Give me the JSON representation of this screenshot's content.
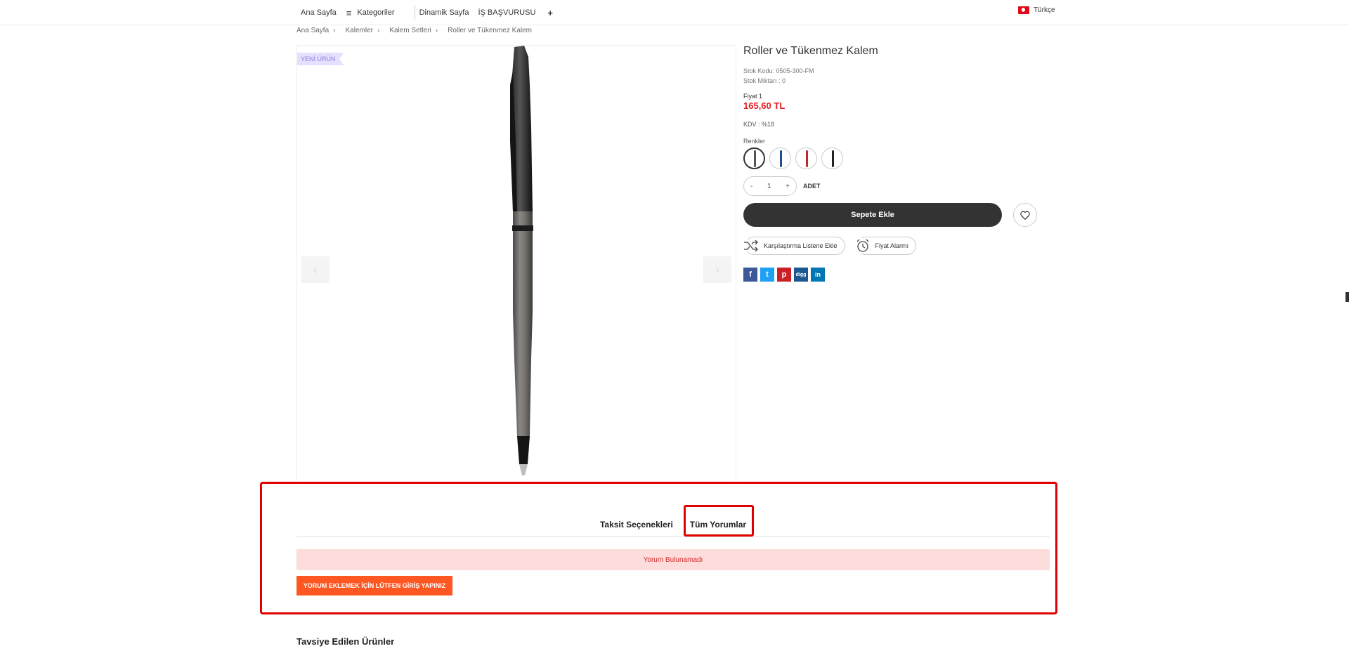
{
  "nav": {
    "home": "Ana Sayfa",
    "categories": "Kategoriler",
    "dynamic_page": "Dinamik Sayfa",
    "job_application": "İŞ BAŞVURUSU",
    "plus": "+",
    "language": "Türkçe"
  },
  "breadcrumb": [
    "Ana Sayfa",
    "Kalemler",
    "Kalem Setleri",
    "Roller ve Tükenmez Kalem"
  ],
  "product": {
    "badge": "YENİ ÜRÜN",
    "title": "Roller ve Tükenmez Kalem",
    "stock_code": "Stok Kodu: 0505-300-FM",
    "stock_qty": "Stok Miktarı : 0",
    "price_label": "Fiyat 1",
    "price": "165,60 TL",
    "kdv": "KDV : %18",
    "colors_label": "Renkler",
    "colors": [
      "#444444",
      "#1f4e8c",
      "#c0262d",
      "#222222"
    ],
    "qty_minus": "-",
    "qty_value": "1",
    "qty_plus": "+",
    "unit": "ADET",
    "add_to_cart": "Sepete Ekle",
    "compare": "Karşılaştırma Listene Ekle",
    "price_alarm": "Fiyat Alarmı"
  },
  "social": {
    "facebook": "f",
    "twitter": "t",
    "pinterest": "p",
    "digg": "digg",
    "linkedin": "in"
  },
  "tabs": {
    "installments": "Taksit Seçenekleri",
    "reviews": "Tüm Yorumlar"
  },
  "reviews": {
    "empty": "Yorum Bulunamadı",
    "login_button": "YORUM EKLEMEK İÇİN LÜTFEN GİRİŞ YAPINIZ"
  },
  "recommended": "Tavsiye Edilen Ürünler",
  "colors": {
    "accent": "#ff5722",
    "price": "#e31e24",
    "highlight": "#e00000"
  }
}
